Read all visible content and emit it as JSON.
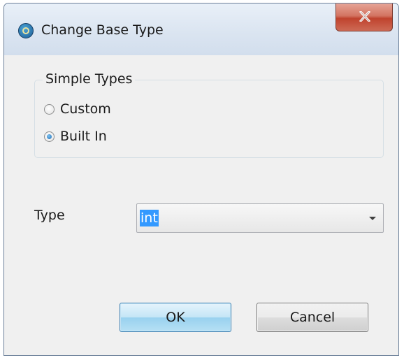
{
  "window": {
    "title": "Change Base Type",
    "app_icon": "talend-app-icon",
    "close_icon": "close-x-icon"
  },
  "simple_types": {
    "legend": "Simple Types",
    "options": [
      {
        "label": "Custom",
        "checked": false
      },
      {
        "label": "Built In",
        "checked": true
      }
    ]
  },
  "type_field": {
    "label": "Type",
    "value": "int"
  },
  "buttons": {
    "ok": "OK",
    "cancel": "Cancel"
  }
}
